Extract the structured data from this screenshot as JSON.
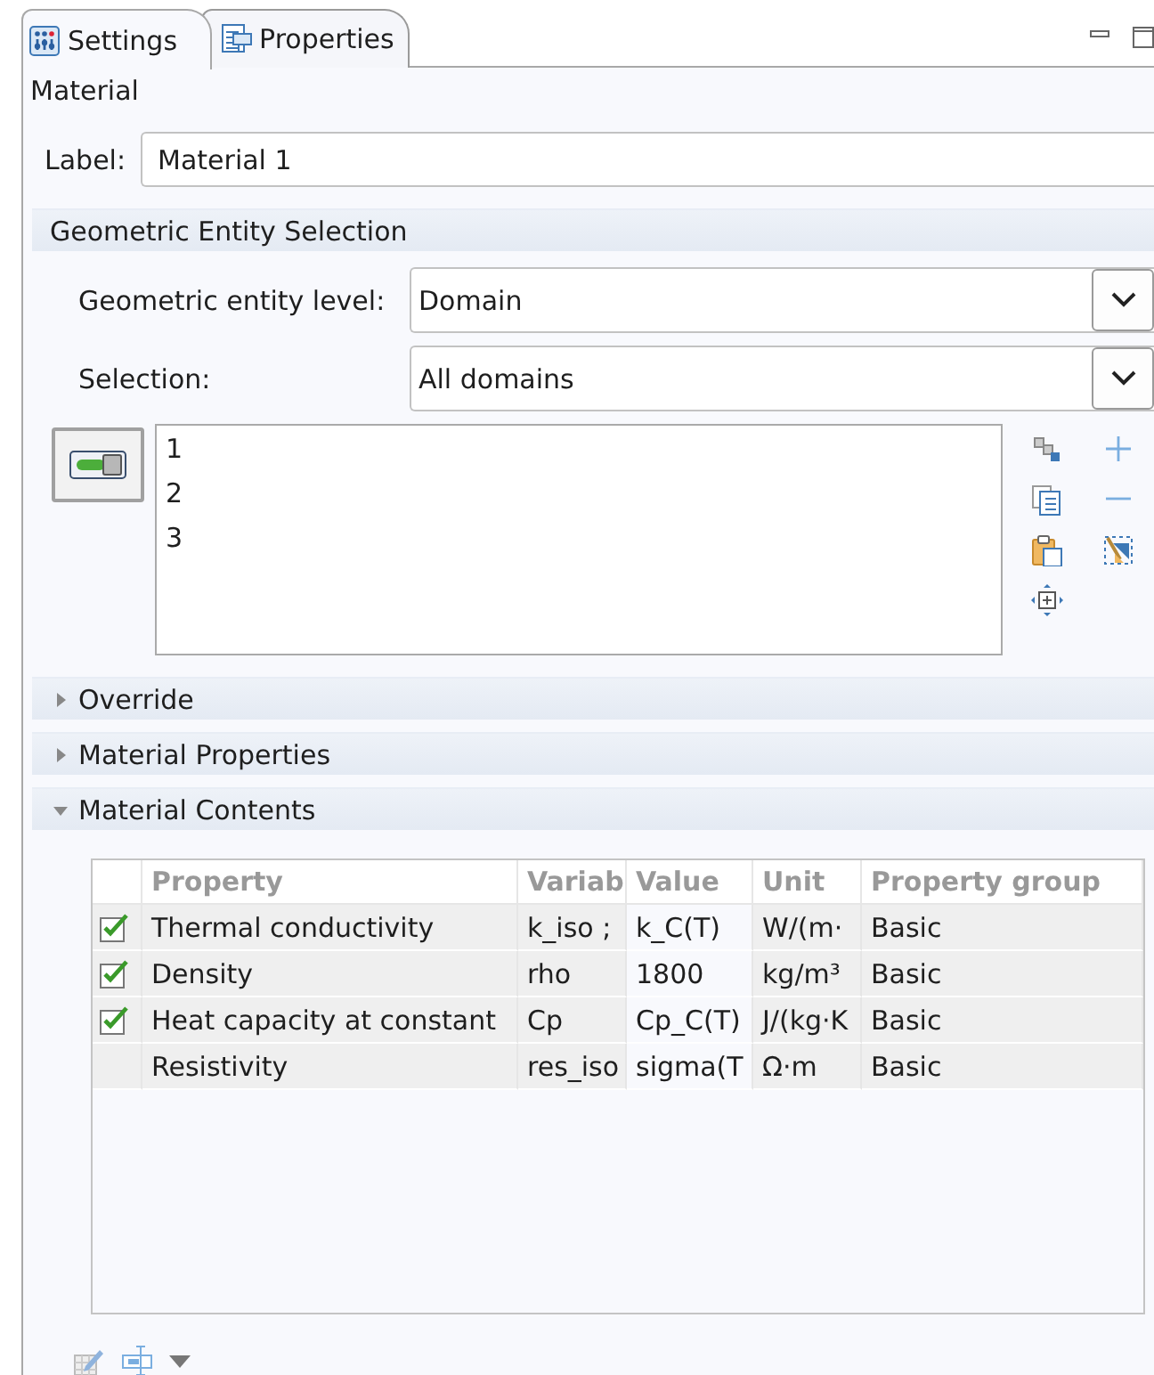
{
  "tabs": [
    {
      "label": "Settings",
      "selected": true
    },
    {
      "label": "Properties",
      "selected": false
    }
  ],
  "node_title": "Material",
  "label_field": {
    "label": "Label:",
    "value": "Material 1"
  },
  "geometric_entity_selection": {
    "title": "Geometric Entity Selection",
    "fields": [
      {
        "label": "Geometric entity level:",
        "value": "Domain"
      },
      {
        "label": "Selection:",
        "value": "All domains"
      }
    ],
    "selection_active": true,
    "selection_list": [
      "1",
      "2",
      "3"
    ]
  },
  "collapsed_sections": [
    {
      "title": "Override",
      "expanded": false
    },
    {
      "title": "Material Properties",
      "expanded": false
    }
  ],
  "material_contents": {
    "title": "Material Contents",
    "expanded": true,
    "columns": [
      "Property",
      "Variab",
      "Value",
      "Unit",
      "Property group"
    ],
    "rows": [
      {
        "checked": true,
        "cells": [
          "Thermal conductivity",
          "k_iso ;",
          "k_C(T)",
          "W/(m·",
          "Basic"
        ]
      },
      {
        "checked": true,
        "cells": [
          "Density",
          "rho",
          "1800",
          "kg/m³",
          "Basic"
        ]
      },
      {
        "checked": true,
        "cells": [
          "Heat capacity at constant",
          "Cp",
          "Cp_C(T)",
          "J/(kg·K",
          "Basic"
        ]
      },
      {
        "checked": false,
        "cells": [
          "Resistivity",
          "res_iso",
          "sigma(T",
          "Ω·m",
          "Basic"
        ]
      }
    ]
  }
}
